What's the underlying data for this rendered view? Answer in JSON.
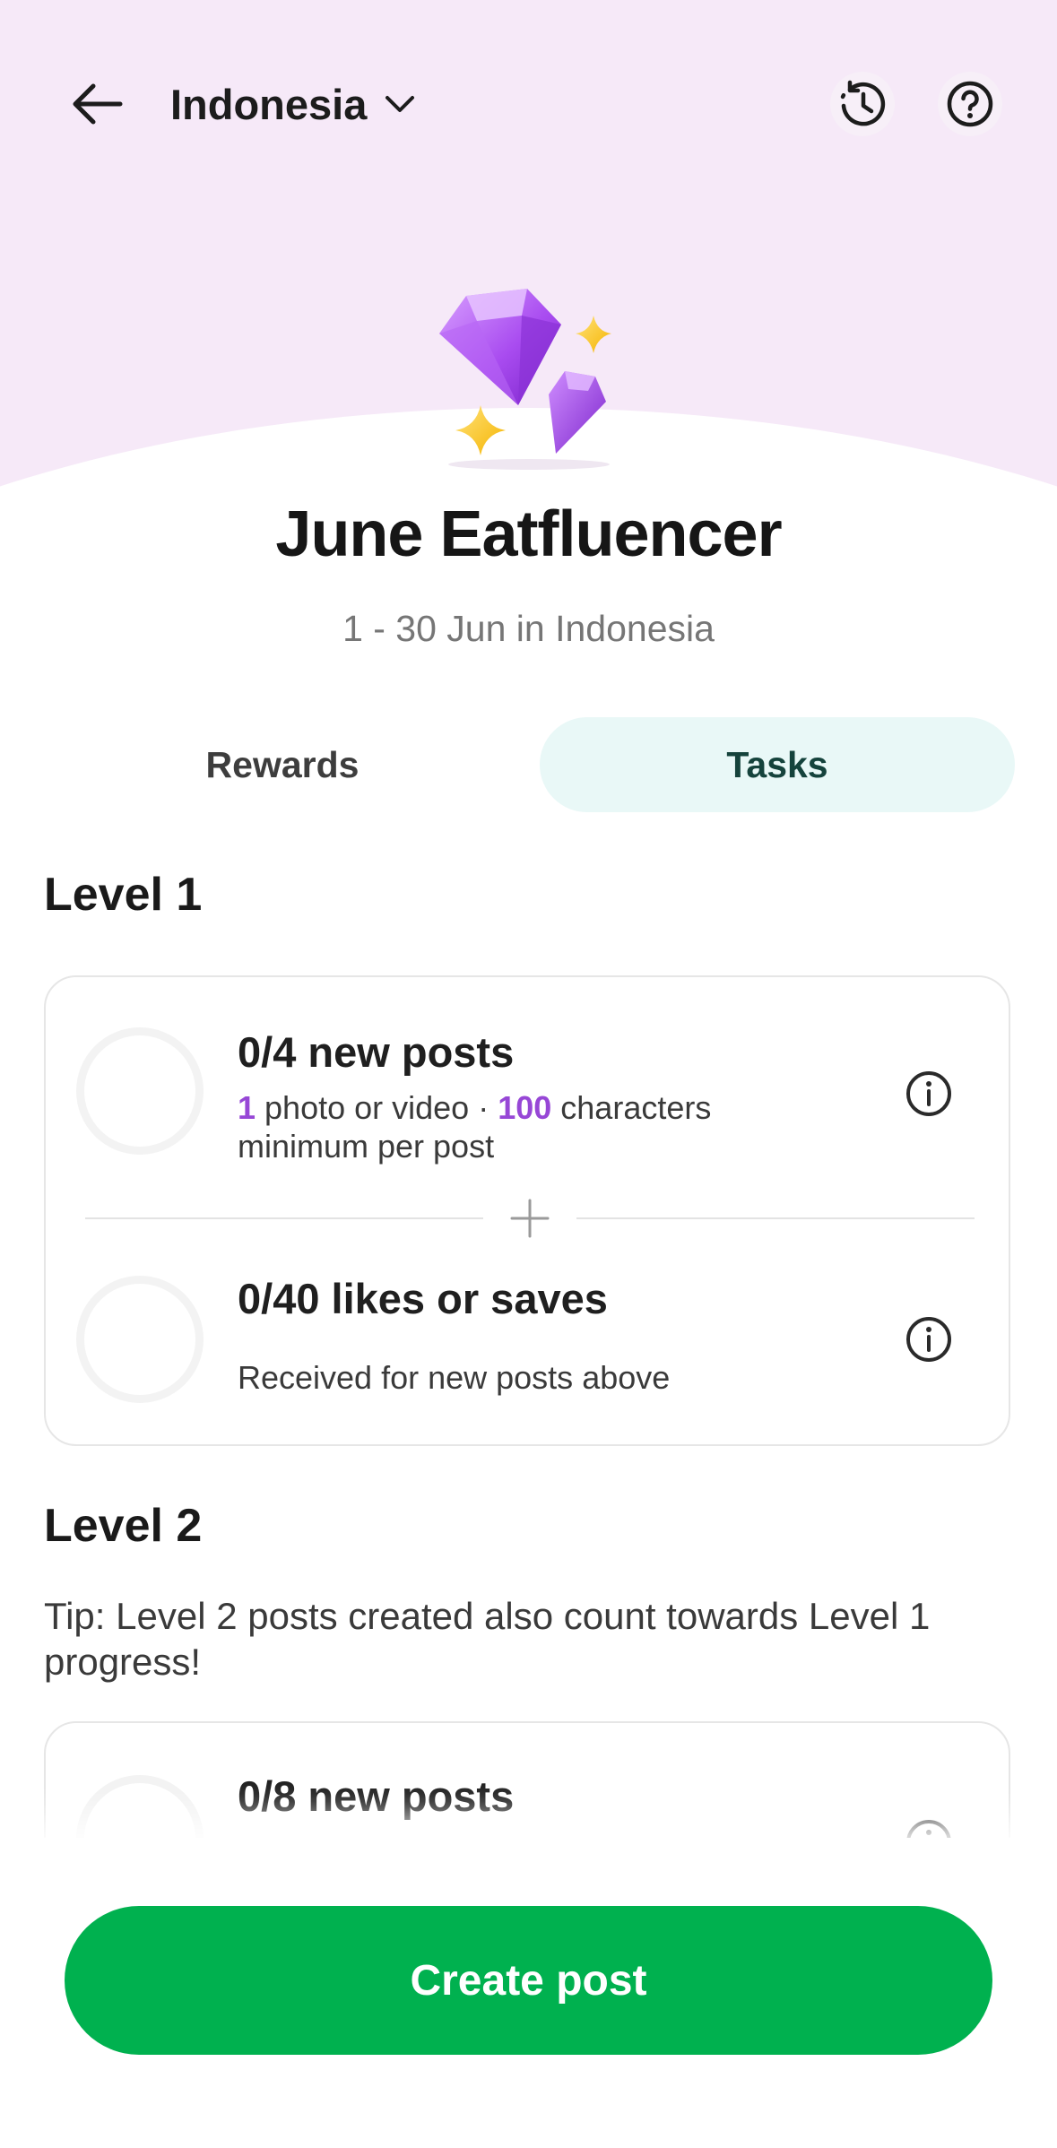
{
  "header": {
    "region": "Indonesia",
    "icons": {
      "back": "arrow-left-icon",
      "region_dropdown": "chevron-down-icon",
      "history": "history-icon",
      "help": "help-circle-icon"
    }
  },
  "hero": {
    "illustration": "gem-sparkles-illustration",
    "title": "June Eatfluencer",
    "subtitle": "1 - 30 Jun in Indonesia"
  },
  "tabs": [
    {
      "label": "Rewards",
      "selected": false
    },
    {
      "label": "Tasks",
      "selected": true
    }
  ],
  "levels": [
    {
      "heading": "Level 1",
      "tasks": [
        {
          "title": "0/4 new posts",
          "progress": 0,
          "desc_parts": {
            "n1": "1",
            "t1": " photo or video · ",
            "n2": "100",
            "t2": " characters minimum per post"
          }
        },
        {
          "title": "0/40 likes or saves",
          "progress": 0,
          "desc": "Received for new posts above"
        }
      ]
    },
    {
      "heading": "Level 2",
      "tip": "Tip: Level 2 posts created also count towards Level 1 progress!",
      "tasks": [
        {
          "title": "0/8 new posts",
          "progress": 0
        }
      ]
    }
  ],
  "footer": {
    "cta_label": "Create post"
  },
  "colors": {
    "hero_bg": "#f6e9f8",
    "tab_selected_bg": "#e9f8f7",
    "highlight": "#9747d6",
    "primary": "#00b14f"
  }
}
